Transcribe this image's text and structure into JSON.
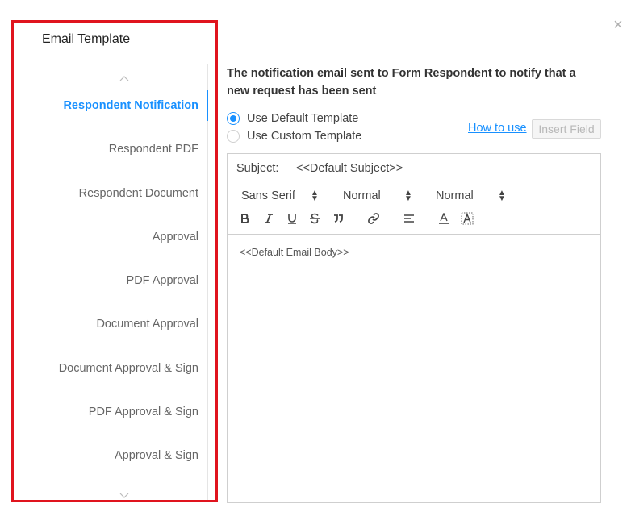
{
  "dialog": {
    "close_glyph": "×"
  },
  "sidebar": {
    "title": "Email Template",
    "items": [
      {
        "label": "Respondent Notification",
        "active": true
      },
      {
        "label": "Respondent PDF",
        "active": false
      },
      {
        "label": "Respondent Document",
        "active": false
      },
      {
        "label": "Approval",
        "active": false
      },
      {
        "label": "PDF Approval",
        "active": false
      },
      {
        "label": "Document Approval",
        "active": false
      },
      {
        "label": "Document Approval & Sign",
        "active": false
      },
      {
        "label": "PDF Approval & Sign",
        "active": false
      },
      {
        "label": "Approval & Sign",
        "active": false
      }
    ],
    "active_color": "#1890ff",
    "highlight_border_color": "#e0141e"
  },
  "main": {
    "description": "The notification email sent to Form Respondent to notify that a new request has been sent",
    "template_options": [
      {
        "label": "Use Default Template",
        "checked": true
      },
      {
        "label": "Use Custom Template",
        "checked": false
      }
    ],
    "how_to_use_label": "How to use",
    "insert_field_label": "Insert Field",
    "editor": {
      "subject_label": "Subject:",
      "subject_value": "<<Default Subject>>",
      "font_family": "Sans Serif",
      "font_size": "Normal",
      "heading": "Normal",
      "toolbar_icons": [
        "bold-icon",
        "italic-icon",
        "underline-icon",
        "strike-icon",
        "blockquote-icon",
        "link-icon",
        "align-icon",
        "text-color-icon",
        "background-color-icon"
      ],
      "body": "<<Default Email Body>>"
    }
  }
}
